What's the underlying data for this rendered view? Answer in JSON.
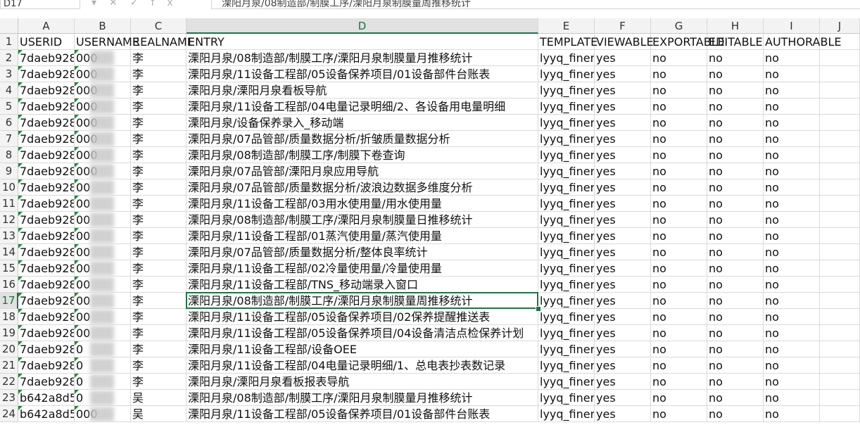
{
  "toolbar": {
    "name_box": "D17",
    "fx_icons": [
      "▾",
      "✕",
      "✓",
      "fx"
    ],
    "formula_value": "溧阳月泉/08制造部/制膜工序/溧阳月泉制膜量周推移统计"
  },
  "columns": [
    {
      "letter": "A",
      "header": "USERID"
    },
    {
      "letter": "B",
      "header": "USERNAME"
    },
    {
      "letter": "C",
      "header": "REALNAME"
    },
    {
      "letter": "D",
      "header": "ENTRY"
    },
    {
      "letter": "E",
      "header": "TEMPLATE"
    },
    {
      "letter": "F",
      "header": "VIEWABLE"
    },
    {
      "letter": "G",
      "header": "EXPORTABLE"
    },
    {
      "letter": "H",
      "header": "EDITABLE"
    },
    {
      "letter": "I",
      "header": "AUTHORABLE"
    },
    {
      "letter": "J",
      "header": ""
    }
  ],
  "selected_cell": {
    "column": "D",
    "row": 17
  },
  "rows": [
    {
      "n": "2",
      "userid": "7daeb928",
      "username": "000",
      "realname": "李",
      "entry": "溧阳月泉/08制造部/制膜工序/溧阳月泉制膜量月推移统计",
      "template": "lyyq_finereport",
      "viewable": "yes",
      "exportable": "no",
      "editable": "no",
      "authorable": "no"
    },
    {
      "n": "3",
      "userid": "7daeb928",
      "username": "000",
      "realname": "李",
      "entry": "溧阳月泉/11设备工程部/05设备保养项目/01设备部件台账表",
      "template": "lyyq_finereport",
      "viewable": "yes",
      "exportable": "no",
      "editable": "no",
      "authorable": "no"
    },
    {
      "n": "4",
      "userid": "7daeb928",
      "username": "000",
      "realname": "李",
      "entry": "溧阳月泉/溧阳月泉看板导航",
      "template": "lyyq_finereport",
      "viewable": "yes",
      "exportable": "no",
      "editable": "no",
      "authorable": "no"
    },
    {
      "n": "5",
      "userid": "7daeb928",
      "username": "000",
      "realname": "李",
      "entry": "溧阳月泉/11设备工程部/04电量记录明细/2、各设备用电量明细",
      "template": "lyyq_finereport",
      "viewable": "yes",
      "exportable": "no",
      "editable": "no",
      "authorable": "no"
    },
    {
      "n": "6",
      "userid": "7daeb928",
      "username": "000",
      "realname": "李",
      "entry": "溧阳月泉/设备保养录入_移动端",
      "template": "lyyq_finereport",
      "viewable": "yes",
      "exportable": "no",
      "editable": "no",
      "authorable": "no"
    },
    {
      "n": "7",
      "userid": "7daeb928",
      "username": "000",
      "realname": "李",
      "entry": "溧阳月泉/07品管部/质量数据分析/折皱质量数据分析",
      "template": "lyyq_finereport",
      "viewable": "yes",
      "exportable": "no",
      "editable": "no",
      "authorable": "no"
    },
    {
      "n": "8",
      "userid": "7daeb928",
      "username": "000",
      "realname": "李",
      "entry": "溧阳月泉/08制造部/制膜工序/制膜下卷查询",
      "template": "lyyq_finereport",
      "viewable": "yes",
      "exportable": "no",
      "editable": "no",
      "authorable": "no"
    },
    {
      "n": "9",
      "userid": "7daeb928",
      "username": "000",
      "realname": "李",
      "entry": "溧阳月泉/07品管部/溧阳月泉应用导航",
      "template": "lyyq_finereport",
      "viewable": "yes",
      "exportable": "no",
      "editable": "no",
      "authorable": "no"
    },
    {
      "n": "10",
      "userid": "7daeb928",
      "username": "00",
      "realname": "李",
      "entry": "溧阳月泉/07品管部/质量数据分析/波浪边数据多维度分析",
      "template": "lyyq_finereport",
      "viewable": "yes",
      "exportable": "no",
      "editable": "no",
      "authorable": "no"
    },
    {
      "n": "11",
      "userid": "7daeb928",
      "username": "00",
      "realname": "李",
      "entry": "溧阳月泉/11设备工程部/03用水使用量/用水使用量",
      "template": "lyyq_finereport",
      "viewable": "yes",
      "exportable": "no",
      "editable": "no",
      "authorable": "no"
    },
    {
      "n": "12",
      "userid": "7daeb928",
      "username": "00",
      "realname": "李",
      "entry": "溧阳月泉/08制造部/制膜工序/溧阳月泉制膜量日推移统计",
      "template": "lyyq_finereport",
      "viewable": "yes",
      "exportable": "no",
      "editable": "no",
      "authorable": "no"
    },
    {
      "n": "13",
      "userid": "7daeb928",
      "username": "00",
      "realname": "李",
      "entry": "溧阳月泉/11设备工程部/01蒸汽使用量/蒸汽使用量",
      "template": "lyyq_finereport",
      "viewable": "yes",
      "exportable": "no",
      "editable": "no",
      "authorable": "no"
    },
    {
      "n": "14",
      "userid": "7daeb928",
      "username": "00",
      "realname": "李",
      "entry": "溧阳月泉/07品管部/质量数据分析/整体良率统计",
      "template": "lyyq_finereport",
      "viewable": "yes",
      "exportable": "no",
      "editable": "no",
      "authorable": "no"
    },
    {
      "n": "15",
      "userid": "7daeb928",
      "username": "00",
      "realname": "李",
      "entry": "溧阳月泉/11设备工程部/02冷量使用量/冷量使用量",
      "template": "lyyq_finereport",
      "viewable": "yes",
      "exportable": "no",
      "editable": "no",
      "authorable": "no"
    },
    {
      "n": "16",
      "userid": "7daeb928",
      "username": "00",
      "realname": "李",
      "entry": "溧阳月泉/11设备工程部/TNS_移动端录入窗口",
      "template": "lyyq_finereport",
      "viewable": "yes",
      "exportable": "no",
      "editable": "no",
      "authorable": "no"
    },
    {
      "n": "17",
      "userid": "7daeb928",
      "username": "00",
      "realname": "李",
      "entry": "溧阳月泉/08制造部/制膜工序/溧阳月泉制膜量周推移统计",
      "template": "lyyq_finereport",
      "viewable": "yes",
      "exportable": "no",
      "editable": "no",
      "authorable": "no"
    },
    {
      "n": "18",
      "userid": "7daeb928",
      "username": "00",
      "realname": "李",
      "entry": "溧阳月泉/11设备工程部/05设备保养项目/02保养提醒推送表",
      "template": "lyyq_finereport",
      "viewable": "yes",
      "exportable": "no",
      "editable": "no",
      "authorable": "no"
    },
    {
      "n": "19",
      "userid": "7daeb928",
      "username": "00",
      "realname": "李",
      "entry": "溧阳月泉/11设备工程部/05设备保养项目/04设备清洁点检保养计划",
      "template": "lyyq_finereport",
      "viewable": "yes",
      "exportable": "no",
      "editable": "no",
      "authorable": "no"
    },
    {
      "n": "20",
      "userid": "7daeb928",
      "username": "0",
      "realname": "李",
      "entry": "溧阳月泉/11设备工程部/设备OEE",
      "template": "lyyq_finereport",
      "viewable": "yes",
      "exportable": "no",
      "editable": "no",
      "authorable": "no"
    },
    {
      "n": "21",
      "userid": "7daeb928",
      "username": "0",
      "realname": "李",
      "entry": "溧阳月泉/11设备工程部/04电量记录明细/1、总电表抄表数记录",
      "template": "lyyq_finereport",
      "viewable": "yes",
      "exportable": "no",
      "editable": "no",
      "authorable": "no"
    },
    {
      "n": "22",
      "userid": "7daeb928",
      "username": "0",
      "realname": "李",
      "entry": "溧阳月泉/溧阳月泉看板报表导航",
      "template": "lyyq_finereport",
      "viewable": "yes",
      "exportable": "no",
      "editable": "no",
      "authorable": "no"
    },
    {
      "n": "23",
      "userid": "b642a8d5",
      "username": "0",
      "realname": "吴",
      "entry": "溧阳月泉/08制造部/制膜工序/溧阳月泉制膜量月推移统计",
      "template": "lyyq_finereport",
      "viewable": "yes",
      "exportable": "no",
      "editable": "no",
      "authorable": "no"
    },
    {
      "n": "24",
      "userid": "b642a8d5",
      "username": "000",
      "realname": "吴",
      "entry": "溧阳月泉/11设备工程部/05设备保养项目/01设备部件台账表",
      "template": "lyyq_finereport",
      "viewable": "yes",
      "exportable": "no",
      "editable": "no",
      "authorable": "no"
    }
  ]
}
